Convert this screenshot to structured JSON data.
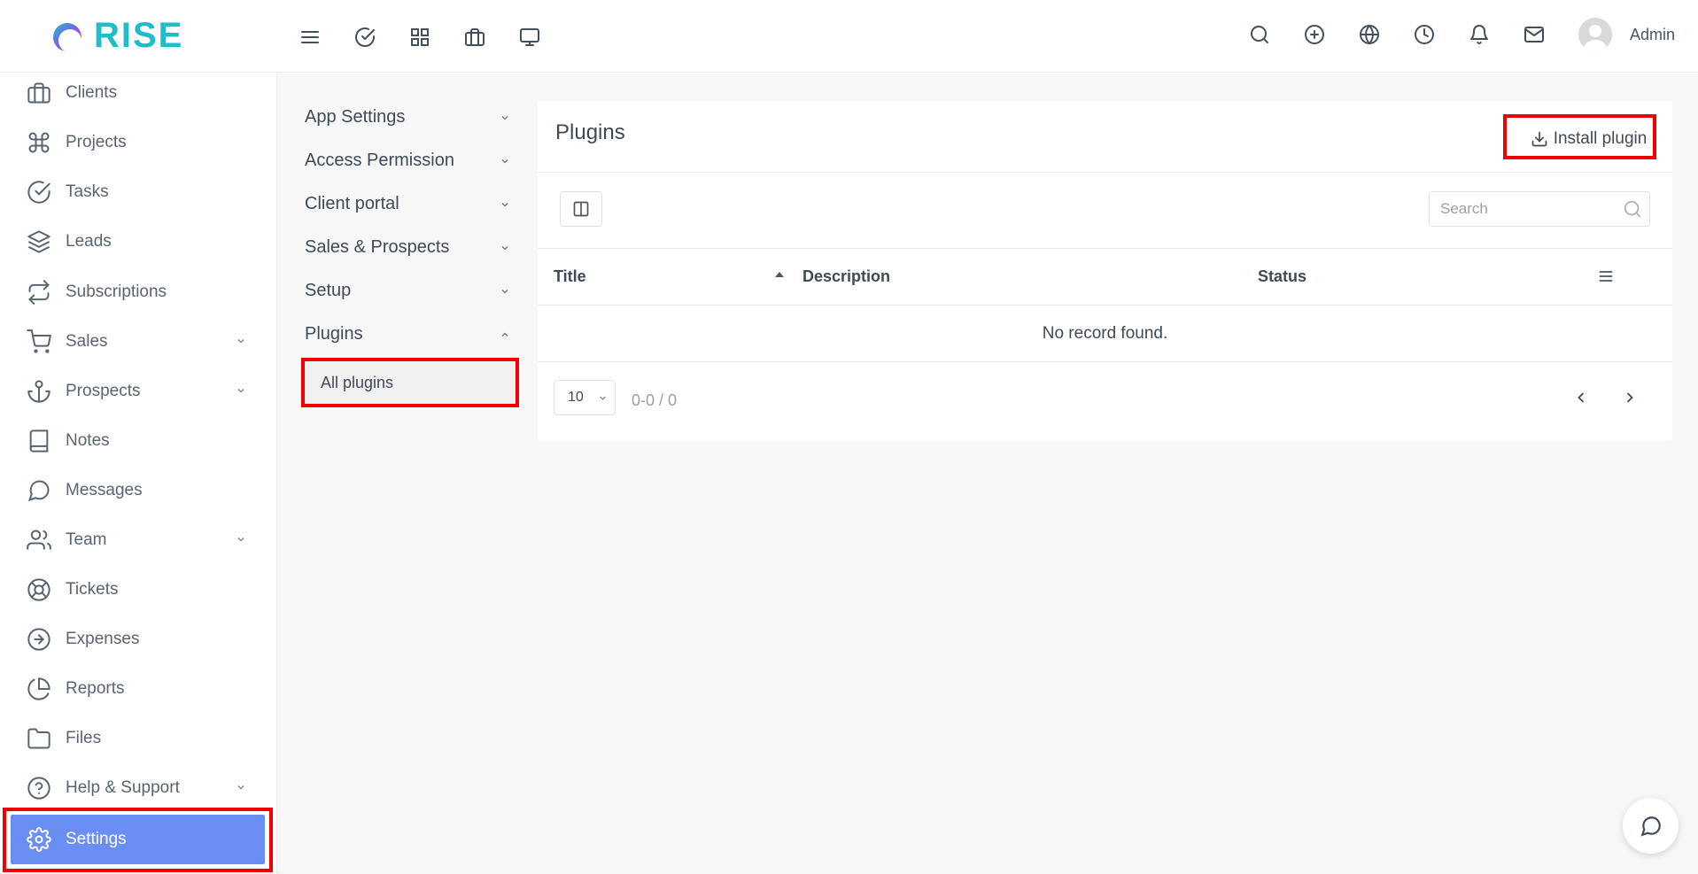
{
  "app": {
    "brand": "RISE",
    "brand_color": "#1fbcc9"
  },
  "topbar": {
    "left_icons": [
      "menu-icon",
      "check-circle-icon",
      "grid-icon",
      "briefcase-icon",
      "monitor-icon"
    ],
    "right_icons": [
      "search-icon",
      "plus-circle-icon",
      "globe-icon",
      "clock-icon",
      "bell-icon",
      "mail-icon"
    ],
    "user_name": "Admin"
  },
  "sidebar": {
    "items": [
      {
        "label": "Clients",
        "icon": "briefcase-icon",
        "has_chevron": false
      },
      {
        "label": "Projects",
        "icon": "command-icon",
        "has_chevron": false
      },
      {
        "label": "Tasks",
        "icon": "check-circle-icon",
        "has_chevron": false
      },
      {
        "label": "Leads",
        "icon": "layers-icon",
        "has_chevron": false
      },
      {
        "label": "Subscriptions",
        "icon": "repeat-icon",
        "has_chevron": false
      },
      {
        "label": "Sales",
        "icon": "cart-icon",
        "has_chevron": true
      },
      {
        "label": "Prospects",
        "icon": "anchor-icon",
        "has_chevron": true
      },
      {
        "label": "Notes",
        "icon": "book-icon",
        "has_chevron": false
      },
      {
        "label": "Messages",
        "icon": "message-circle-icon",
        "has_chevron": false
      },
      {
        "label": "Team",
        "icon": "users-icon",
        "has_chevron": true
      },
      {
        "label": "Tickets",
        "icon": "life-buoy-icon",
        "has_chevron": false
      },
      {
        "label": "Expenses",
        "icon": "arrow-right-circle-icon",
        "has_chevron": false
      },
      {
        "label": "Reports",
        "icon": "pie-chart-icon",
        "has_chevron": false
      },
      {
        "label": "Files",
        "icon": "folder-icon",
        "has_chevron": false
      },
      {
        "label": "Help & Support",
        "icon": "help-circle-icon",
        "has_chevron": true
      },
      {
        "label": "Settings",
        "icon": "gear-icon",
        "has_chevron": false,
        "active": true
      }
    ],
    "active_color": "#6b8ef5"
  },
  "settings_menu": {
    "items": [
      {
        "label": "App Settings",
        "expanded": false
      },
      {
        "label": "Access Permission",
        "expanded": false
      },
      {
        "label": "Client portal",
        "expanded": false
      },
      {
        "label": "Sales & Prospects",
        "expanded": false
      },
      {
        "label": "Setup",
        "expanded": false
      },
      {
        "label": "Plugins",
        "expanded": true
      }
    ],
    "sub_item": "All plugins"
  },
  "plugins_panel": {
    "title": "Plugins",
    "install_button": "Install plugin",
    "search_placeholder": "Search",
    "columns": [
      "Title",
      "Description",
      "Status"
    ],
    "empty_message": "No record found.",
    "page_size": "10",
    "page_info": "0-0 / 0"
  },
  "highlight_color": "#f20000"
}
